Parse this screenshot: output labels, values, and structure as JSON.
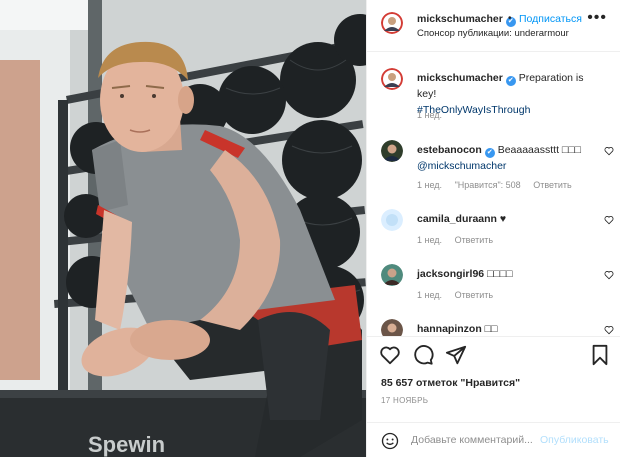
{
  "colors": {
    "accent": "#0095f6",
    "verified": "#3897f0",
    "muted": "#8e8e8e",
    "text": "#262626",
    "publish_disabled": "#b2dffc"
  },
  "photo": {
    "alt": "mickschumacher post photo",
    "gym_text": "Spewin"
  },
  "header": {
    "username": "mickschumacher",
    "verified_icon": "✔",
    "separator": "•",
    "follow_label": "Подписаться",
    "sponsor_text": "Спонсор публикации: underarmour",
    "more_icon": "•••"
  },
  "caption": {
    "username": "mickschumacher",
    "text_line1": "Preparation is key!",
    "hashtag": "#TheOnlyWayIsThrough",
    "time": "1 нед."
  },
  "comments": [
    {
      "username": "estebanocon",
      "verified": true,
      "text": "Beaaaaassttt □□□",
      "mention": "@mickschumacher",
      "time": "1 нед.",
      "likes": "\"Нравится\": 508",
      "reply": "Ответить"
    },
    {
      "username": "camila_duraann",
      "text": "♥",
      "time": "1 нед.",
      "reply": "Ответить"
    },
    {
      "username": "jacksongirl96",
      "text": "□□□□",
      "time": "1 нед.",
      "reply": "Ответить"
    },
    {
      "username": "hannapinzon",
      "text": "□□",
      "time": "",
      "reply": ""
    }
  ],
  "actions": {
    "like_icon": "heart-icon",
    "comment_icon": "comment-icon",
    "share_icon": "share-icon",
    "save_icon": "bookmark-icon"
  },
  "likes_text": "85 657 отметок \"Нравится\"",
  "date_text": "17 ноябрь",
  "add_comment": {
    "placeholder": "Добавьте комментарий...",
    "publish_label": "Опубликовать"
  }
}
